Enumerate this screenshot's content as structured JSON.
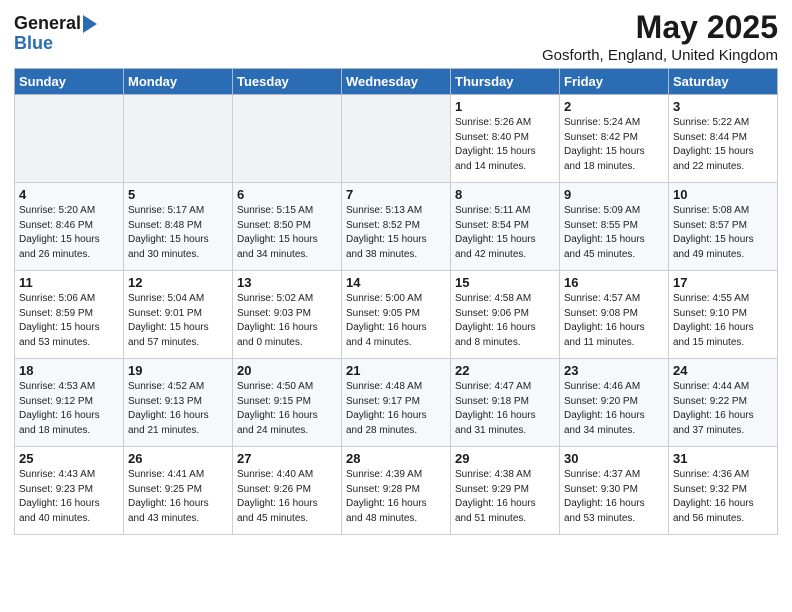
{
  "header": {
    "logo_general": "General",
    "logo_blue": "Blue",
    "title": "May 2025",
    "subtitle": "Gosforth, England, United Kingdom"
  },
  "columns": [
    "Sunday",
    "Monday",
    "Tuesday",
    "Wednesday",
    "Thursday",
    "Friday",
    "Saturday"
  ],
  "weeks": [
    [
      {
        "day": "",
        "detail": "",
        "empty": true
      },
      {
        "day": "",
        "detail": "",
        "empty": true
      },
      {
        "day": "",
        "detail": "",
        "empty": true
      },
      {
        "day": "",
        "detail": "",
        "empty": true
      },
      {
        "day": "1",
        "detail": "Sunrise: 5:26 AM\nSunset: 8:40 PM\nDaylight: 15 hours\nand 14 minutes."
      },
      {
        "day": "2",
        "detail": "Sunrise: 5:24 AM\nSunset: 8:42 PM\nDaylight: 15 hours\nand 18 minutes."
      },
      {
        "day": "3",
        "detail": "Sunrise: 5:22 AM\nSunset: 8:44 PM\nDaylight: 15 hours\nand 22 minutes."
      }
    ],
    [
      {
        "day": "4",
        "detail": "Sunrise: 5:20 AM\nSunset: 8:46 PM\nDaylight: 15 hours\nand 26 minutes."
      },
      {
        "day": "5",
        "detail": "Sunrise: 5:17 AM\nSunset: 8:48 PM\nDaylight: 15 hours\nand 30 minutes."
      },
      {
        "day": "6",
        "detail": "Sunrise: 5:15 AM\nSunset: 8:50 PM\nDaylight: 15 hours\nand 34 minutes."
      },
      {
        "day": "7",
        "detail": "Sunrise: 5:13 AM\nSunset: 8:52 PM\nDaylight: 15 hours\nand 38 minutes."
      },
      {
        "day": "8",
        "detail": "Sunrise: 5:11 AM\nSunset: 8:54 PM\nDaylight: 15 hours\nand 42 minutes."
      },
      {
        "day": "9",
        "detail": "Sunrise: 5:09 AM\nSunset: 8:55 PM\nDaylight: 15 hours\nand 45 minutes."
      },
      {
        "day": "10",
        "detail": "Sunrise: 5:08 AM\nSunset: 8:57 PM\nDaylight: 15 hours\nand 49 minutes."
      }
    ],
    [
      {
        "day": "11",
        "detail": "Sunrise: 5:06 AM\nSunset: 8:59 PM\nDaylight: 15 hours\nand 53 minutes."
      },
      {
        "day": "12",
        "detail": "Sunrise: 5:04 AM\nSunset: 9:01 PM\nDaylight: 15 hours\nand 57 minutes."
      },
      {
        "day": "13",
        "detail": "Sunrise: 5:02 AM\nSunset: 9:03 PM\nDaylight: 16 hours\nand 0 minutes."
      },
      {
        "day": "14",
        "detail": "Sunrise: 5:00 AM\nSunset: 9:05 PM\nDaylight: 16 hours\nand 4 minutes."
      },
      {
        "day": "15",
        "detail": "Sunrise: 4:58 AM\nSunset: 9:06 PM\nDaylight: 16 hours\nand 8 minutes."
      },
      {
        "day": "16",
        "detail": "Sunrise: 4:57 AM\nSunset: 9:08 PM\nDaylight: 16 hours\nand 11 minutes."
      },
      {
        "day": "17",
        "detail": "Sunrise: 4:55 AM\nSunset: 9:10 PM\nDaylight: 16 hours\nand 15 minutes."
      }
    ],
    [
      {
        "day": "18",
        "detail": "Sunrise: 4:53 AM\nSunset: 9:12 PM\nDaylight: 16 hours\nand 18 minutes."
      },
      {
        "day": "19",
        "detail": "Sunrise: 4:52 AM\nSunset: 9:13 PM\nDaylight: 16 hours\nand 21 minutes."
      },
      {
        "day": "20",
        "detail": "Sunrise: 4:50 AM\nSunset: 9:15 PM\nDaylight: 16 hours\nand 24 minutes."
      },
      {
        "day": "21",
        "detail": "Sunrise: 4:48 AM\nSunset: 9:17 PM\nDaylight: 16 hours\nand 28 minutes."
      },
      {
        "day": "22",
        "detail": "Sunrise: 4:47 AM\nSunset: 9:18 PM\nDaylight: 16 hours\nand 31 minutes."
      },
      {
        "day": "23",
        "detail": "Sunrise: 4:46 AM\nSunset: 9:20 PM\nDaylight: 16 hours\nand 34 minutes."
      },
      {
        "day": "24",
        "detail": "Sunrise: 4:44 AM\nSunset: 9:22 PM\nDaylight: 16 hours\nand 37 minutes."
      }
    ],
    [
      {
        "day": "25",
        "detail": "Sunrise: 4:43 AM\nSunset: 9:23 PM\nDaylight: 16 hours\nand 40 minutes."
      },
      {
        "day": "26",
        "detail": "Sunrise: 4:41 AM\nSunset: 9:25 PM\nDaylight: 16 hours\nand 43 minutes."
      },
      {
        "day": "27",
        "detail": "Sunrise: 4:40 AM\nSunset: 9:26 PM\nDaylight: 16 hours\nand 45 minutes."
      },
      {
        "day": "28",
        "detail": "Sunrise: 4:39 AM\nSunset: 9:28 PM\nDaylight: 16 hours\nand 48 minutes."
      },
      {
        "day": "29",
        "detail": "Sunrise: 4:38 AM\nSunset: 9:29 PM\nDaylight: 16 hours\nand 51 minutes."
      },
      {
        "day": "30",
        "detail": "Sunrise: 4:37 AM\nSunset: 9:30 PM\nDaylight: 16 hours\nand 53 minutes."
      },
      {
        "day": "31",
        "detail": "Sunrise: 4:36 AM\nSunset: 9:32 PM\nDaylight: 16 hours\nand 56 minutes."
      }
    ]
  ]
}
